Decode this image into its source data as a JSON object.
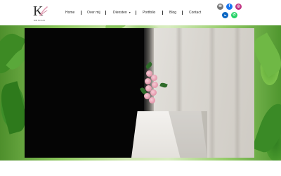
{
  "brand": {
    "logo_letter": "K",
    "logo_text": "DESIGN"
  },
  "nav": {
    "items": [
      {
        "label": "Home"
      },
      {
        "label": "Over mij"
      },
      {
        "label": "Diensten"
      },
      {
        "label": "Portfolio"
      },
      {
        "label": "Blog"
      },
      {
        "label": "Contact"
      }
    ]
  },
  "social": [
    {
      "icon": "email-icon",
      "glyph": "✉",
      "color": "#777777"
    },
    {
      "icon": "facebook-icon",
      "glyph": "f",
      "color": "#1877f2"
    },
    {
      "icon": "instagram-icon",
      "glyph": "◎",
      "color": "#c13584"
    },
    {
      "icon": "linkedin-icon",
      "glyph": "in",
      "color": "#0a66c2"
    },
    {
      "icon": "whatsapp-icon",
      "glyph": "✆",
      "color": "#25d366"
    }
  ],
  "colors": {
    "accent_pink": "#e6a0b6",
    "text_dark": "#2a2a2a"
  }
}
